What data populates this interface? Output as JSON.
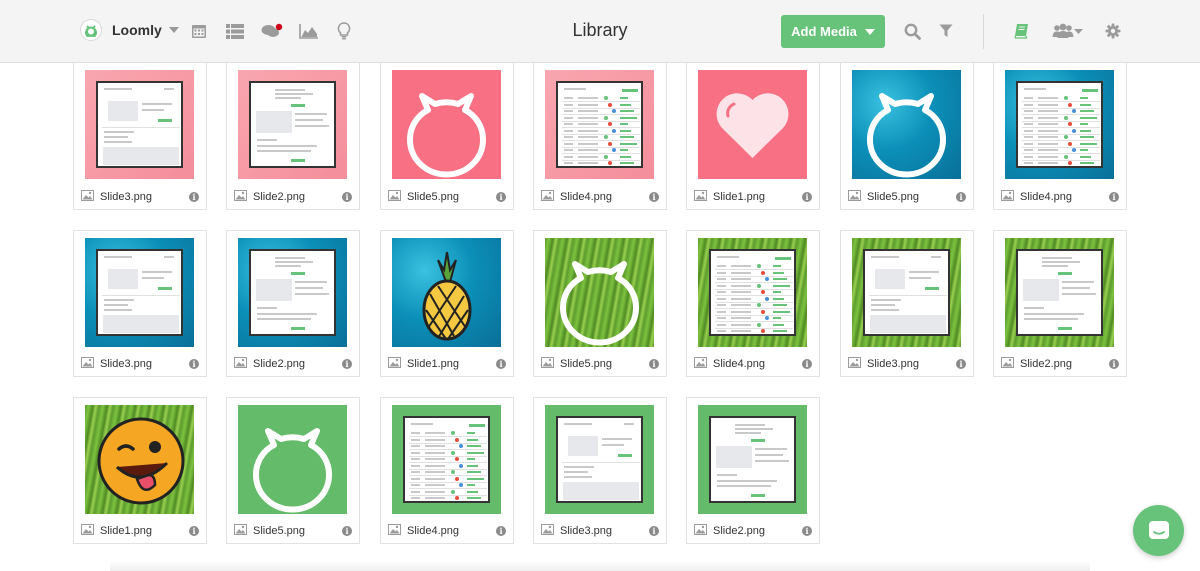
{
  "header": {
    "brand": "Loomly",
    "title": "Library",
    "add_media_label": "Add Media",
    "nav_icons": [
      "calendar-icon",
      "list-icon",
      "comments-icon",
      "analytics-icon",
      "idea-bulb-icon"
    ],
    "right_icons": [
      "search-icon",
      "filter-icon",
      "library-book-icon",
      "team-icon",
      "settings-gear-icon"
    ],
    "accent_color": "#67c27a",
    "notification_color": "#d0021b"
  },
  "library": {
    "rows": [
      [
        {
          "name": "Slide3.png",
          "bg": "pink",
          "content": "screenshot-a"
        },
        {
          "name": "Slide2.png",
          "bg": "pink",
          "content": "screenshot-b"
        },
        {
          "name": "Slide5.png",
          "bg": "pink2",
          "content": "cat-outline"
        },
        {
          "name": "Slide4.png",
          "bg": "pink",
          "content": "screenshot-table"
        },
        {
          "name": "Slide1.png",
          "bg": "pink2",
          "content": "heart"
        },
        {
          "name": "Slide5.png",
          "bg": "water",
          "content": "cat-outline"
        },
        {
          "name": "Slide4.png",
          "bg": "water",
          "content": "screenshot-table"
        }
      ],
      [
        {
          "name": "Slide3.png",
          "bg": "water",
          "content": "screenshot-a"
        },
        {
          "name": "Slide2.png",
          "bg": "water",
          "content": "screenshot-b"
        },
        {
          "name": "Slide1.png",
          "bg": "water",
          "content": "pineapple"
        },
        {
          "name": "Slide5.png",
          "bg": "grass",
          "content": "cat-outline"
        },
        {
          "name": "Slide4.png",
          "bg": "grass",
          "content": "screenshot-table"
        },
        {
          "name": "Slide3.png",
          "bg": "grass",
          "content": "screenshot-a"
        },
        {
          "name": "Slide2.png",
          "bg": "grass",
          "content": "screenshot-b"
        }
      ],
      [
        {
          "name": "Slide1.png",
          "bg": "grass",
          "content": "emoji"
        },
        {
          "name": "Slide5.png",
          "bg": "green",
          "content": "cat-outline"
        },
        {
          "name": "Slide4.png",
          "bg": "green",
          "content": "screenshot-table"
        },
        {
          "name": "Slide3.png",
          "bg": "green",
          "content": "screenshot-a"
        },
        {
          "name": "Slide2.png",
          "bg": "green",
          "content": "screenshot-b"
        }
      ]
    ],
    "file_type_icon": "image-file-icon",
    "info_icon": "info-icon",
    "info_glyph": "i"
  },
  "chat": {
    "icon": "chat-bubble-icon"
  }
}
